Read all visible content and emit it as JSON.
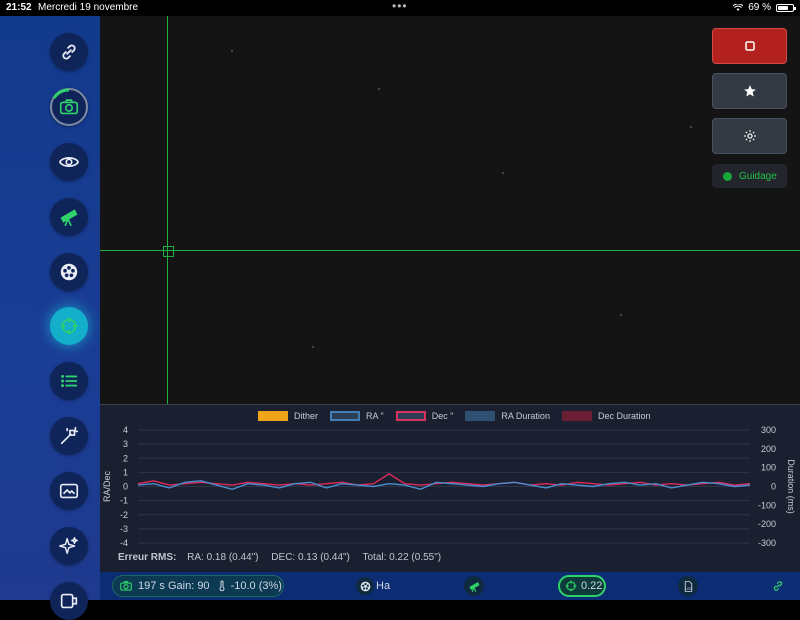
{
  "status_bar": {
    "time": "21:52",
    "date": "Mercredi 19 novembre",
    "battery": "69 %",
    "battery_level": 0.69
  },
  "sidebar": {
    "items": [
      {
        "name": "connection",
        "icon": "link-icon"
      },
      {
        "name": "camera",
        "icon": "camera-icon"
      },
      {
        "name": "view",
        "icon": "eye-icon"
      },
      {
        "name": "telescope",
        "icon": "telescope-icon"
      },
      {
        "name": "filter-wheel",
        "icon": "filter-wheel-icon"
      },
      {
        "name": "guiding",
        "icon": "crosshair-icon",
        "active": true
      },
      {
        "name": "sequence",
        "icon": "list-icon"
      },
      {
        "name": "focus-wand",
        "icon": "magic-wand-icon"
      },
      {
        "name": "image-viewer",
        "icon": "image-icon"
      },
      {
        "name": "effects",
        "icon": "sparkles-icon"
      },
      {
        "name": "storage",
        "icon": "storage-icon"
      }
    ]
  },
  "controls": {
    "stop_icon": "stop-icon",
    "star_icon": "star-icon",
    "settings_icon": "gear-icon",
    "guiding_label": "Guidage",
    "guiding_color": "#18a83a"
  },
  "graph": {
    "legend": [
      {
        "label": "Dither",
        "color": "#f0a418",
        "outline": false
      },
      {
        "label": "RA \"",
        "color": "#3f7fb5",
        "outline": true
      },
      {
        "label": "Dec \"",
        "color": "#d83060",
        "outline": true
      },
      {
        "label": "RA Duration",
        "color": "#2f4f73",
        "outline": false
      },
      {
        "label": "Dec Duration",
        "color": "#6a1f35",
        "outline": false
      }
    ],
    "y_left_label": "RA/Dec",
    "y_right_label": "Duration (ms)",
    "y_left_ticks": [
      "4",
      "3",
      "2",
      "1",
      "0",
      "-1",
      "-2",
      "-3",
      "-4"
    ],
    "y_right_ticks": [
      "300",
      "200",
      "100",
      "0",
      "-100",
      "-200",
      "-300"
    ],
    "rms_title": "Erreur RMS:",
    "rms_ra": "RA: 0.18 (0.44\")",
    "rms_dec": "DEC: 0.13 (0.44\")",
    "rms_total": "Total: 0.22 (0.55\")"
  },
  "chart_data": {
    "type": "line",
    "ylim": [
      -4,
      4
    ],
    "y2lim": [
      -300,
      300
    ],
    "series": [
      {
        "name": "RA \"",
        "values": [
          0.1,
          0.2,
          -0.1,
          0.3,
          0.4,
          0.1,
          -0.2,
          0.2,
          0.1,
          -0.1,
          0.2,
          0.3,
          -0.1,
          0.2,
          0.1,
          0.0,
          0.2,
          0.1,
          -0.2,
          0.3,
          0.2,
          0.1,
          0.0,
          0.2,
          0.3,
          0.1,
          -0.1,
          0.2,
          0.1,
          0.0,
          0.2,
          0.3,
          0.1,
          0.2,
          -0.1,
          0.1,
          0.3,
          0.2,
          0.0,
          0.1
        ]
      },
      {
        "name": "Dec \"",
        "values": [
          0.2,
          0.4,
          0.1,
          0.2,
          0.3,
          0.2,
          0.1,
          0.3,
          0.2,
          0.1,
          0.2,
          0.1,
          0.2,
          0.3,
          0.1,
          0.2,
          0.9,
          0.2,
          0.1,
          0.2,
          0.3,
          0.2,
          0.1,
          0.2,
          0.3,
          0.1,
          0.2,
          0.1,
          0.3,
          0.2,
          0.1,
          0.2,
          0.3,
          0.1,
          0.2,
          0.1,
          0.2,
          0.3,
          0.1,
          0.2
        ]
      }
    ]
  },
  "bottom_bar": {
    "camera_status": "197 s Gain: 90",
    "temperature": "-10.0 (3%)",
    "filter": "Ha",
    "guiding_rms": "0.22",
    "log_label": "LOG"
  }
}
